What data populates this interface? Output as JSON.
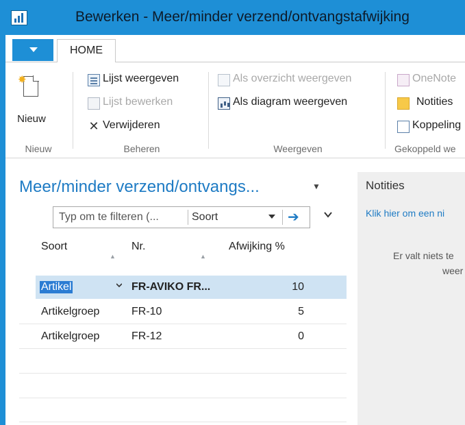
{
  "window": {
    "title": "Bewerken - Meer/minder verzend/ontvangstafwijking"
  },
  "tabs": {
    "home_label": "HOME"
  },
  "ribbon": {
    "groups": {
      "nieuw": {
        "label": "Nieuw",
        "new_button": "Nieuw"
      },
      "beheren": {
        "label": "Beheren",
        "view_list": "Lijst weergeven",
        "edit_list": "Lijst bewerken",
        "delete": "Verwijderen"
      },
      "weergeven": {
        "label": "Weergeven",
        "show_overview": "Als overzicht weergeven",
        "show_chart": "Als diagram weergeven"
      },
      "gekoppeld": {
        "label": "Gekoppeld we",
        "onenote": "OneNote",
        "notes": "Notities",
        "links": "Koppeling"
      }
    }
  },
  "list": {
    "title": "Meer/minder verzend/ontvangs...",
    "filter": {
      "placeholder": "Typ om te filteren (... ",
      "field": "Soort"
    },
    "columns": {
      "soort": "Soort",
      "nr": "Nr.",
      "afwijking": "Afwijking %"
    },
    "rows": [
      {
        "soort": "Artikel",
        "nr": "FR-AVIKO FR...",
        "afwijking": "10"
      },
      {
        "soort": "Artikelgroep",
        "nr": "FR-10",
        "afwijking": "5"
      },
      {
        "soort": "Artikelgroep",
        "nr": "FR-12",
        "afwijking": "0"
      }
    ]
  },
  "notes_pane": {
    "title": "Notities",
    "add_link": "Klik hier om een ni",
    "empty_line1": "Er valt niets te",
    "empty_line2": "weer"
  },
  "colors": {
    "accent": "#1e8fd6",
    "link": "#1e7bc4",
    "selected_row": "#cfe3f3",
    "selection_highlight": "#2b7cd3"
  }
}
